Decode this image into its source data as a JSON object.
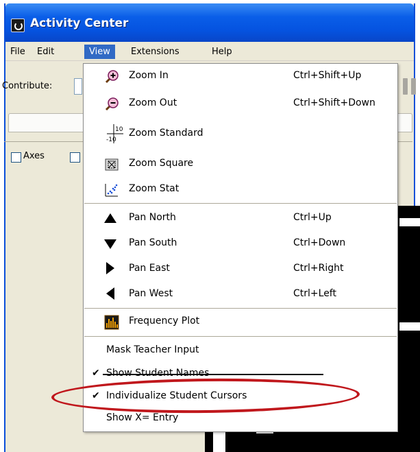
{
  "window": {
    "title": "Activity Center"
  },
  "menubar": {
    "items": [
      "File",
      "Edit",
      "View",
      "Extensions",
      "Help"
    ],
    "active": "View"
  },
  "toolbar": {
    "contribute_label": "Contribute:"
  },
  "panel": {
    "axes_label": "Axes"
  },
  "view_menu": {
    "zoom": [
      {
        "label": "Zoom In",
        "shortcut": "Ctrl+Shift+Up",
        "icon": "zoom-in-icon"
      },
      {
        "label": "Zoom Out",
        "shortcut": "Ctrl+Shift+Down",
        "icon": "zoom-out-icon"
      },
      {
        "label": "Zoom Standard",
        "shortcut": "",
        "icon": "zoom-standard-icon"
      },
      {
        "label": "Zoom Square",
        "shortcut": "",
        "icon": "zoom-square-icon"
      },
      {
        "label": "Zoom Stat",
        "shortcut": "",
        "icon": "zoom-stat-icon"
      }
    ],
    "zoom_standard_icon_text": {
      "top": "10",
      "bottom": "-10"
    },
    "pan": [
      {
        "label": "Pan North",
        "shortcut": "Ctrl+Up",
        "icon": "arrow-up-icon"
      },
      {
        "label": "Pan South",
        "shortcut": "Ctrl+Down",
        "icon": "arrow-down-icon"
      },
      {
        "label": "Pan East",
        "shortcut": "Ctrl+Right",
        "icon": "arrow-right-icon"
      },
      {
        "label": "Pan West",
        "shortcut": "Ctrl+Left",
        "icon": "arrow-left-icon"
      }
    ],
    "frequency_plot": {
      "label": "Frequency Plot",
      "icon": "frequency-plot-icon"
    },
    "options": [
      {
        "label": "Mask Teacher Input",
        "checked": false
      },
      {
        "label": "Show Student Names",
        "checked": true
      },
      {
        "label": "Individualize Student Cursors",
        "checked": true
      },
      {
        "label": "Show X= Entry",
        "checked": false
      }
    ]
  },
  "colors": {
    "titlebar": "#0553e0",
    "menu_highlight": "#316ac5",
    "annotation_oval": "#c0171c",
    "window_bg": "#ece9d8"
  }
}
